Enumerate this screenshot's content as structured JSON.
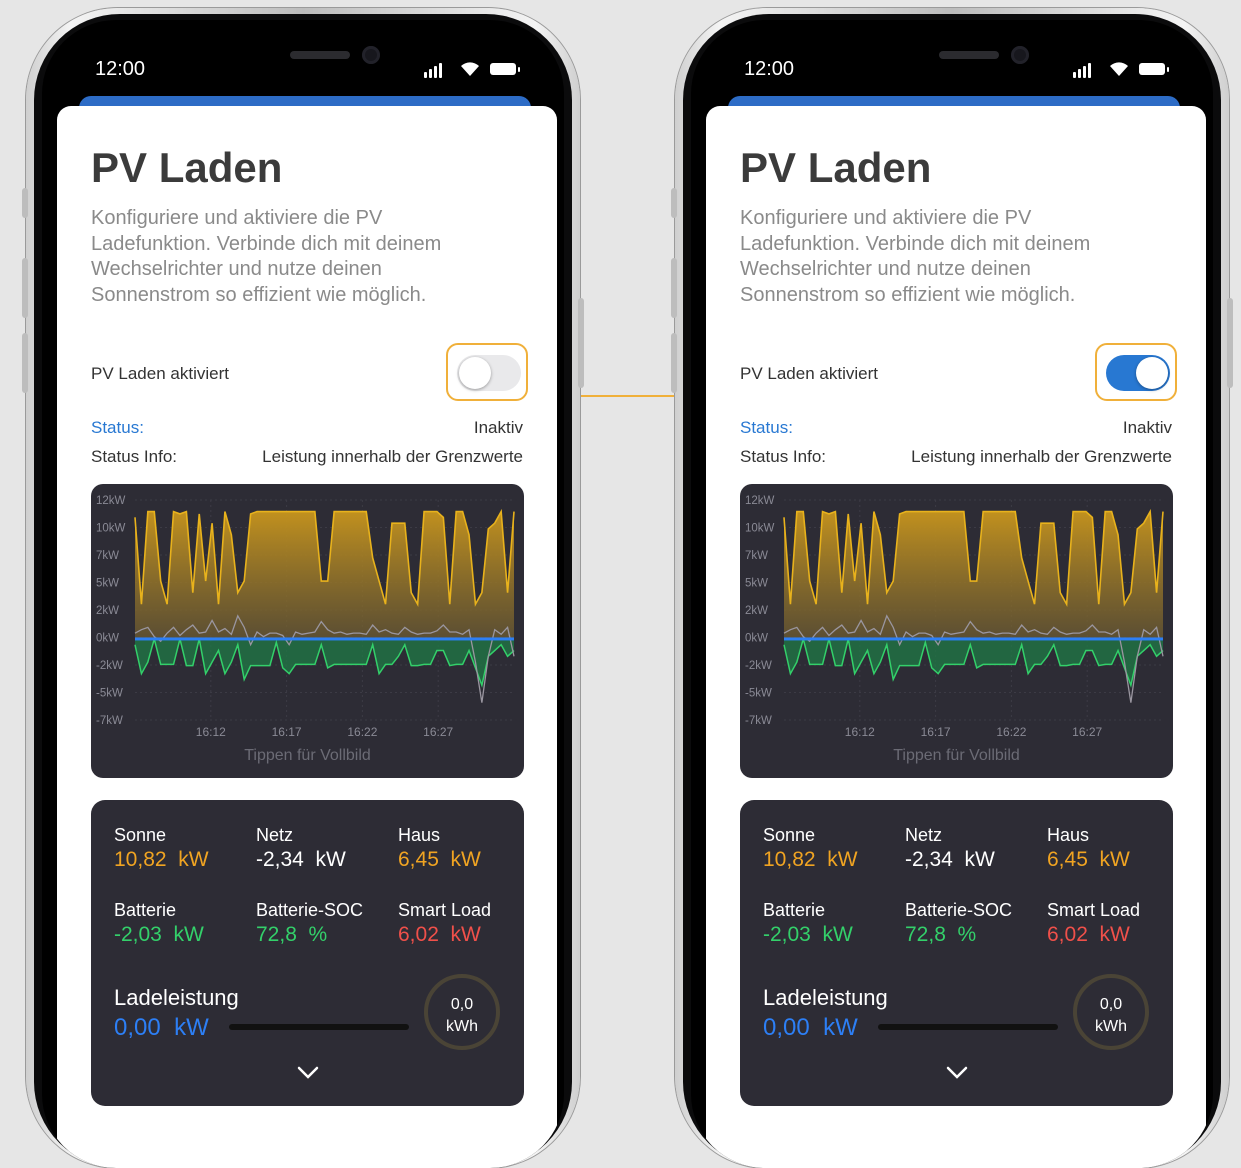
{
  "status_bar": {
    "time": "12:00"
  },
  "page": {
    "title": "PV Laden",
    "description": "Konfiguriere und aktiviere die PV Ladefunktion. Verbinde dich mit deinem Wechselrichter und nutze deinen Sonnenstrom so effizient wie möglich.",
    "toggle_label": "PV Laden aktiviert",
    "status_key": "Status:",
    "status_value": "Inaktiv",
    "status_info_key": "Status Info:",
    "status_info_value": "Leistung innerhalb der Grenzwerte",
    "chart_hint": "Tippen für Vollbild"
  },
  "toggle_states": {
    "left": "off",
    "right": "on"
  },
  "metrics": {
    "sonne": {
      "label": "Sonne",
      "value": "10,82",
      "unit": "kW"
    },
    "netz": {
      "label": "Netz",
      "value": "-2,34",
      "unit": "kW"
    },
    "haus": {
      "label": "Haus",
      "value": "6,45",
      "unit": "kW"
    },
    "batterie": {
      "label": "Batterie",
      "value": "-2,03",
      "unit": "kW"
    },
    "batterie_soc": {
      "label": "Batterie-SOC",
      "value": "72,8",
      "unit": "%"
    },
    "smart_load": {
      "label": "Smart Load",
      "value": "6,02",
      "unit": "kW"
    },
    "ladeleistung": {
      "label": "Ladeleistung",
      "value": "0,00",
      "unit": "kW"
    },
    "energy": {
      "value": "0,0",
      "unit": "kWh"
    }
  },
  "colors": {
    "accent": "#2878d2",
    "highlight": "#f0b03a",
    "sonne": "#f0a422",
    "haus": "#f0a422",
    "batterie": "#33d06a",
    "smart_load": "#f0504a",
    "ladeleistung": "#2d7ff5"
  },
  "chart_data": {
    "type": "area",
    "y_ticks": [
      "12kW",
      "10kW",
      "7kW",
      "5kW",
      "2kW",
      "0kW",
      "-2kW",
      "-5kW",
      "-7kW"
    ],
    "x_ticks": [
      "16:12",
      "16:17",
      "16:22",
      "16:27"
    ],
    "ylim": [
      -7,
      12
    ],
    "x": [
      0,
      1,
      2,
      3,
      4,
      5,
      6,
      7,
      8,
      9,
      10,
      11,
      12,
      13,
      14,
      15,
      16,
      17,
      18,
      19,
      20,
      21,
      22,
      23,
      24,
      25,
      26,
      27,
      28,
      29,
      30,
      31,
      32,
      33,
      34,
      35,
      36,
      37,
      38,
      39,
      40,
      41,
      42,
      43,
      44,
      45,
      46,
      47,
      48,
      49,
      50,
      51,
      52,
      53,
      54,
      55,
      56,
      57,
      58,
      59
    ],
    "series": [
      {
        "color": "#e8b21c",
        "values": [
          10.5,
          3,
          11,
          11,
          5,
          3,
          11,
          10.8,
          11,
          4,
          10.8,
          5,
          10,
          3,
          11,
          9,
          4,
          5,
          10.8,
          11,
          11,
          11,
          11,
          11,
          11,
          11,
          11,
          11,
          11,
          5,
          5,
          11,
          11,
          11,
          11,
          11,
          11,
          7,
          5,
          3,
          10,
          10,
          10,
          4,
          3,
          11,
          11,
          11,
          10.5,
          3,
          11,
          11,
          9,
          3,
          4,
          9.5,
          10,
          11,
          4,
          11
        ]
      },
      {
        "color": "#33d06a",
        "values": [
          -0.5,
          -3,
          -2,
          0,
          -2.2,
          -2.2,
          -2.2,
          0,
          -2.3,
          -2.3,
          0,
          -3,
          -2,
          -1,
          -3,
          -2,
          -0.5,
          -3.5,
          -2.3,
          -2.3,
          -2.3,
          -2.3,
          -0.3,
          -2.5,
          -3,
          -2.2,
          -2.2,
          -2.2,
          -2.2,
          -0.5,
          -2.5,
          -2.2,
          -2.2,
          -2.2,
          -2.2,
          -2.2,
          -2.2,
          -0.5,
          -3,
          -2.2,
          -2.2,
          -1.5,
          -0.5,
          -2.3,
          -2.3,
          -2.2,
          -2.2,
          -1,
          -1,
          -2.3,
          -2.2,
          -2.2,
          -1,
          -2.5,
          -4,
          -1.5,
          -1,
          -0.5,
          -1.5,
          -1
        ]
      },
      {
        "color": "#9a96a0",
        "values": [
          0.5,
          0.8,
          1,
          0.2,
          -0.2,
          0.5,
          1,
          0.3,
          0.8,
          1.2,
          0.5,
          0.6,
          1.6,
          0.6,
          0.9,
          0.4,
          2,
          1,
          -0.5,
          0.6,
          0.2,
          0.5,
          0.5,
          0.3,
          -0.5,
          0.6,
          0.4,
          0.5,
          0.6,
          1.5,
          0.8,
          0.5,
          0.6,
          0.4,
          0.5,
          0.5,
          0.4,
          1.2,
          0.6,
          0.8,
          0.5,
          0.4,
          1,
          0.6,
          0.4,
          0.5,
          0.5,
          0.7,
          1.2,
          0.6,
          0.6,
          0.4,
          0.8,
          -2,
          -5.5,
          -1.5,
          0.8,
          0.4,
          1,
          -1.5
        ]
      }
    ]
  }
}
